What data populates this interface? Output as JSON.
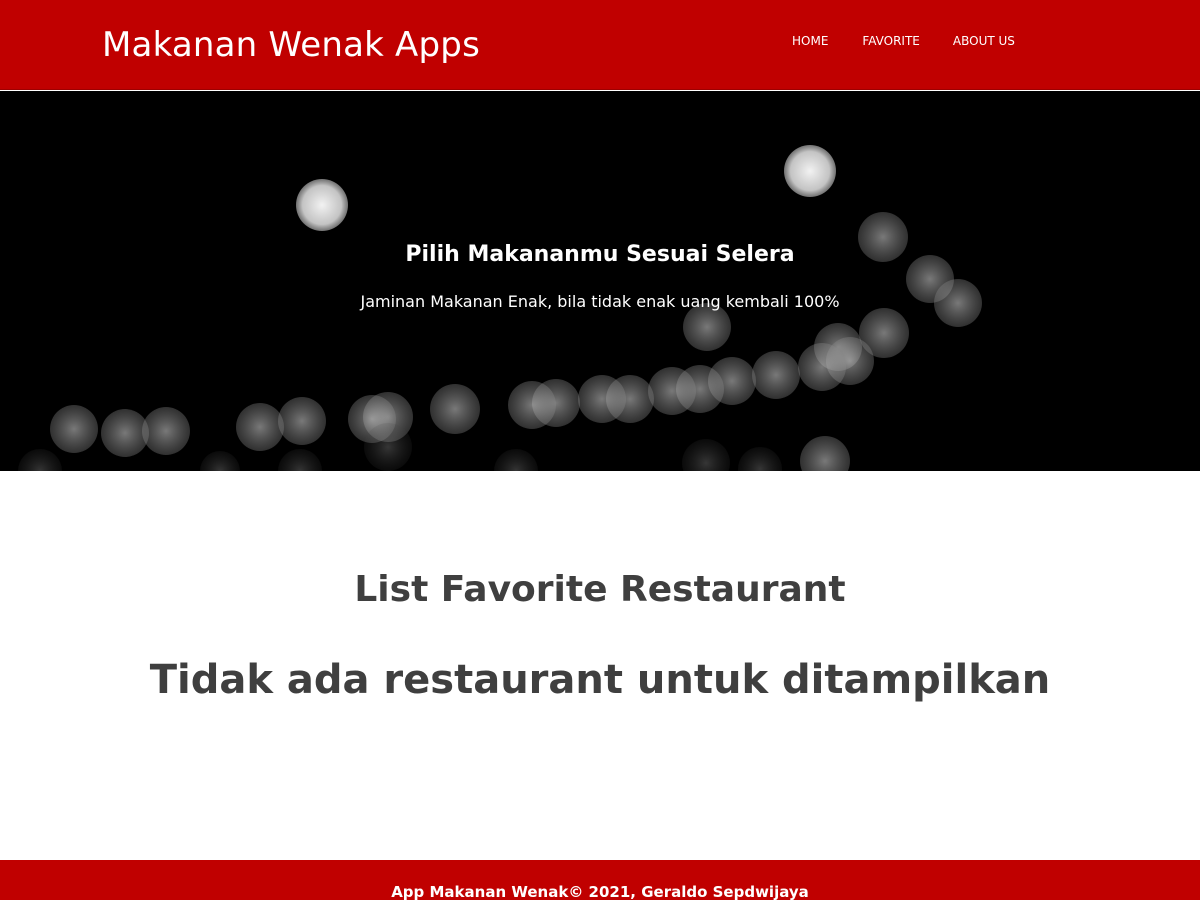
{
  "header": {
    "app_title": "Makanan Wenak Apps",
    "background_color": "#c00000",
    "nav": {
      "home": "HOME",
      "favorite": "FAVORITE",
      "about": "ABOUT US"
    }
  },
  "hero": {
    "title": "Pilih Makananmu Sesuai Selera",
    "subtitle": "Jaminan Makanan Enak, bila tidak enak uang kembali 100%",
    "background_description_color": "#000000"
  },
  "main": {
    "section_title": "List Favorite Restaurant",
    "empty_message": "Tidak ada restaurant untuk ditampilkan",
    "text_color": "#3f3f3f"
  },
  "footer": {
    "text": "App Makanan Wenak© 2021, Geraldo Sepdwijaya",
    "background_color": "#c00000"
  }
}
